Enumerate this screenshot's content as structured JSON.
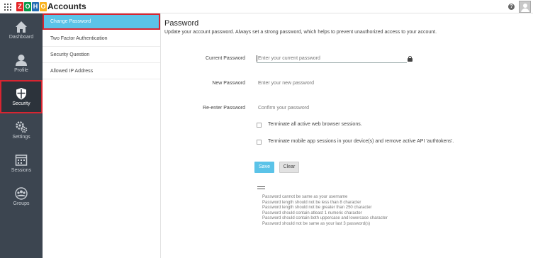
{
  "header": {
    "logo_letters": [
      "Z",
      "O",
      "H",
      "O"
    ],
    "logo_colors": [
      "#e42527",
      "#089949",
      "#226db4",
      "#f9b21d"
    ],
    "title": "Accounts",
    "help_icon": "help-icon",
    "help_glyph": "?",
    "avatar_icon": "user-avatar-icon"
  },
  "sidebar": {
    "items": [
      {
        "label": "Dashboard",
        "icon": "home-icon"
      },
      {
        "label": "Profile",
        "icon": "user-icon"
      },
      {
        "label": "Security",
        "icon": "shield-icon",
        "active": true
      },
      {
        "label": "Settings",
        "icon": "gears-icon"
      },
      {
        "label": "Sessions",
        "icon": "sessions-icon"
      },
      {
        "label": "Groups",
        "icon": "groups-icon"
      }
    ]
  },
  "subnav": {
    "items": [
      {
        "label": "Change Password",
        "active": true
      },
      {
        "label": "Two Factor Authentication"
      },
      {
        "label": "Security Question"
      },
      {
        "label": "Allowed IP Address"
      }
    ]
  },
  "main": {
    "title": "Password",
    "subtitle": "Update your account password. Always set a strong password, which helps to prevent unauthorized access to your account.",
    "fields": [
      {
        "label": "Current Password",
        "placeholder": "Enter your current password",
        "value": ""
      },
      {
        "label": "New Password",
        "placeholder": "Enter your new password",
        "value": ""
      },
      {
        "label": "Re-enter Password",
        "placeholder": "Confirm your password",
        "value": ""
      }
    ],
    "checkboxes": [
      {
        "label": "Terminate all active web browser sessions.",
        "checked": false
      },
      {
        "label": "Terminate mobile app sessions in your device(s) and remove active API 'authtokens'.",
        "checked": false
      }
    ],
    "save_label": "Save",
    "clear_label": "Clear",
    "rules": [
      "Password cannot be same as your username",
      "Password length should not be less than 8 character",
      "Password length should not be greater than 250 character",
      "Password should contain atleast 1 numeric character",
      "Password should contain both uppercase and lowercase character",
      "Password should not be same as your last 3 password(s)"
    ]
  },
  "colors": {
    "accent": "#5bc3e8",
    "highlight": "#d72531",
    "sidebar_bg": "#3c4550"
  }
}
